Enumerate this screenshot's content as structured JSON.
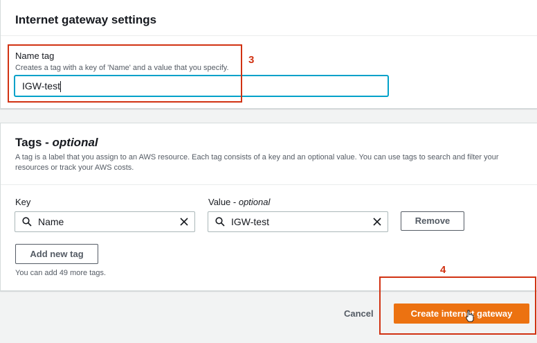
{
  "igw_settings": {
    "title": "Internet gateway settings",
    "name_tag_label": "Name tag",
    "name_tag_description": "Creates a tag with a key of 'Name' and a value that you specify.",
    "name_tag_value": "IGW-test"
  },
  "tags": {
    "title_main": "Tags - ",
    "title_optional": "optional",
    "description": "A tag is a label that you assign to an AWS resource. Each tag consists of a key and an optional value. You can use tags to search and filter your resources or track your AWS costs.",
    "key_label": "Key",
    "value_label_main": "Value - ",
    "value_label_optional": "optional",
    "rows": [
      {
        "key": "Name",
        "value": "IGW-test"
      }
    ],
    "remove_button": "Remove",
    "add_button": "Add new tag",
    "remaining_text": "You can add 49 more tags."
  },
  "footer": {
    "cancel_label": "Cancel",
    "create_label": "Create internet gateway"
  },
  "annotations": {
    "step3": "3",
    "step4": "4"
  },
  "colors": {
    "primary_button": "#ec7211",
    "focus_ring": "#00a1c9",
    "annotation": "#d13212"
  }
}
